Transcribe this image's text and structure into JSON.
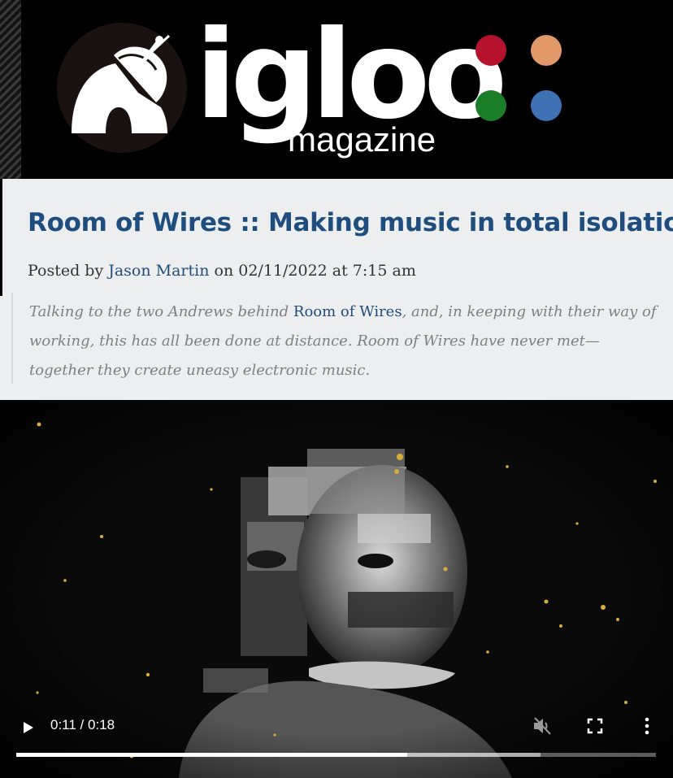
{
  "header": {
    "logo_word": "igloo",
    "logo_sub": "magazine",
    "dot_colors": [
      "#b5122e",
      "#e3986a",
      "#1a7d27",
      "#3f72b4"
    ]
  },
  "article": {
    "title": "Room of Wires :: Making music in total isolation",
    "byline_prefix": "Posted by",
    "author": "Jason Martin",
    "date_prefix": "on",
    "date": "02/11/2022 at 7:15 am",
    "excerpt_part1": "Talking to the two Andrews behind ",
    "excerpt_link": "Room of Wires",
    "excerpt_part2": ", and, in keeping with their way of working, this has all been done at distance. Room of Wires have never met—together they create uneasy electronic music.",
    "title_color": "#1f4e7e"
  },
  "video": {
    "current_time": "0:11",
    "separator": " / ",
    "duration": "0:18",
    "progress": 0.611,
    "buffered": 0.82,
    "play_icon": "play-icon",
    "mute_icon": "muted-speaker-icon",
    "fullscreen_icon": "fullscreen-icon",
    "more_icon": "more-vertical-icon"
  }
}
